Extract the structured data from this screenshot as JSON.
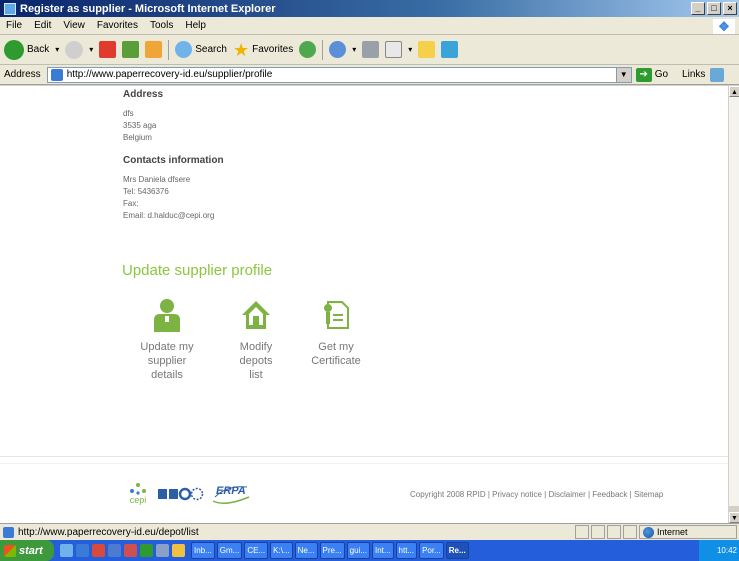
{
  "window": {
    "title": "Register as supplier - Microsoft Internet Explorer",
    "controls": [
      "_",
      "□",
      "×"
    ]
  },
  "menu": {
    "items": [
      "File",
      "Edit",
      "View",
      "Favorites",
      "Tools",
      "Help"
    ]
  },
  "toolbar": {
    "back_label": "Back",
    "search_label": "Search",
    "favorites_label": "Favorites"
  },
  "address_bar": {
    "label": "Address",
    "url": "http://www.paperrecovery-id.eu/supplier/profile",
    "go_label": "Go",
    "links_label": "Links"
  },
  "page": {
    "address_title": "Address",
    "address_lines": [
      "dfs",
      "3535 aga",
      "Belgium"
    ],
    "contacts_title": "Contacts information",
    "contact_lines": [
      "Mrs Daniela dfsere",
      "Tel: 5436376",
      "Fax:",
      "Email: d.halduc@cepi.org"
    ],
    "update_title": "Update supplier profile",
    "actions": [
      {
        "label": "Update my supplier details",
        "icon": "user-icon"
      },
      {
        "label": "Modify depots list",
        "icon": "house-icon"
      },
      {
        "label": "Get my Certificate",
        "icon": "certificate-icon"
      }
    ],
    "footer": {
      "copyright": "Copyright 2008 RPID | Privacy notice | Disclaimer | Feedback | Sitemap",
      "logos": [
        "cepi",
        "ERPA"
      ]
    },
    "colors": {
      "accent_green": "#8cc63f",
      "muted_text": "#777777"
    }
  },
  "status_bar": {
    "text": "http://www.paperrecovery-id.eu/depot/list",
    "zone": "Internet"
  },
  "taskbar": {
    "start_label": "start",
    "tasks": [
      "Inb...",
      "Gm...",
      "CE...",
      "K:\\...",
      "Ne...",
      "Pre...",
      "gui...",
      "Int...",
      "htt...",
      "Por...",
      "Re..."
    ],
    "clock": "10:42"
  }
}
